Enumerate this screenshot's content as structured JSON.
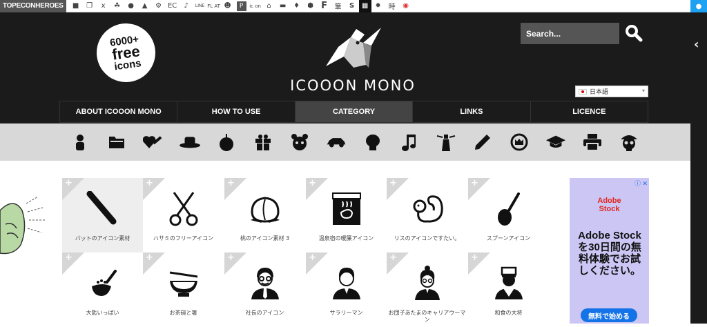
{
  "topbar": {
    "brand": "TOPECONHEROES",
    "icons": [
      "cow-icon",
      "copy-icon",
      "person-icon",
      "leaf-icon",
      "chat-icon",
      "ghost-icon",
      "gear-icon",
      "ec-text",
      "note-icon",
      "line-text",
      "flat-text",
      "smile-icon",
      "p-icon",
      "icon-text",
      "house-icon",
      "car-icon",
      "bird-icon",
      "hexagon-icon",
      "f-icon",
      "brush-icon",
      "s-icon",
      "grid-icon",
      "burst-icon",
      "time-kanji",
      "avatar-icon"
    ],
    "labels": {
      "ec": "EC",
      "line": "LINE",
      "flat": "FL AT",
      "icon": "ic on",
      "toki": "時",
      "fu": "筆",
      "s": "S",
      "f": "F"
    }
  },
  "header": {
    "badge": {
      "count": "6000+",
      "free": "free",
      "icons": "icons"
    },
    "logo_text": "ICOOON MONO",
    "search_placeholder": "Search...",
    "language": "日本語"
  },
  "nav": [
    {
      "label": "ABOUT ICOOON MONO",
      "active": false
    },
    {
      "label": "HOW TO USE",
      "active": false
    },
    {
      "label": "CATEGORY",
      "active": true
    },
    {
      "label": "LINKS",
      "active": false
    },
    {
      "label": "LICENCE",
      "active": false
    }
  ],
  "categories": [
    "person-icon",
    "folder-icon",
    "heart-syringe-icon",
    "hat-icon",
    "apple-icon",
    "gift-icon",
    "bear-icon",
    "car-icon",
    "boxing-glove-icon",
    "music-note-icon",
    "lighthouse-icon",
    "pencil-icon",
    "crown-icon",
    "graduation-cap-icon",
    "printer-icon",
    "pirate-skull-icon"
  ],
  "icons": [
    {
      "name": "bat-icon",
      "caption": "バットのアイコン素材"
    },
    {
      "name": "scissors-icon",
      "caption": "ハサミのフリーアイコン"
    },
    {
      "name": "peach-icon",
      "caption": "桃のアイコン素材 3"
    },
    {
      "name": "onsen-curtain-icon",
      "caption": "温泉宿の暖簾アイコン"
    },
    {
      "name": "squirrel-icon",
      "caption": "リスのアイコンですたい。"
    },
    {
      "name": "spoon-icon",
      "caption": "スプーンアイコン"
    },
    {
      "name": "ladle-icon",
      "caption": "大匙いっぱい"
    },
    {
      "name": "tea-bowl-icon",
      "caption": "お茶碗と箸"
    },
    {
      "name": "president-icon",
      "caption": "社長のアイコン"
    },
    {
      "name": "salaryman-icon",
      "caption": "サラリーマン"
    },
    {
      "name": "career-woman-icon",
      "caption": "お団子あたまのキャリアウーマン"
    },
    {
      "name": "sushi-chef-icon",
      "caption": "和食の大将"
    }
  ],
  "ad": {
    "brand_line1": "Adobe",
    "brand_line2": "Stock",
    "copy": "Adobe Stockを30日間の無料体験でお試しください。",
    "cta": "無料で始める",
    "close": "ⓘ ✕"
  }
}
